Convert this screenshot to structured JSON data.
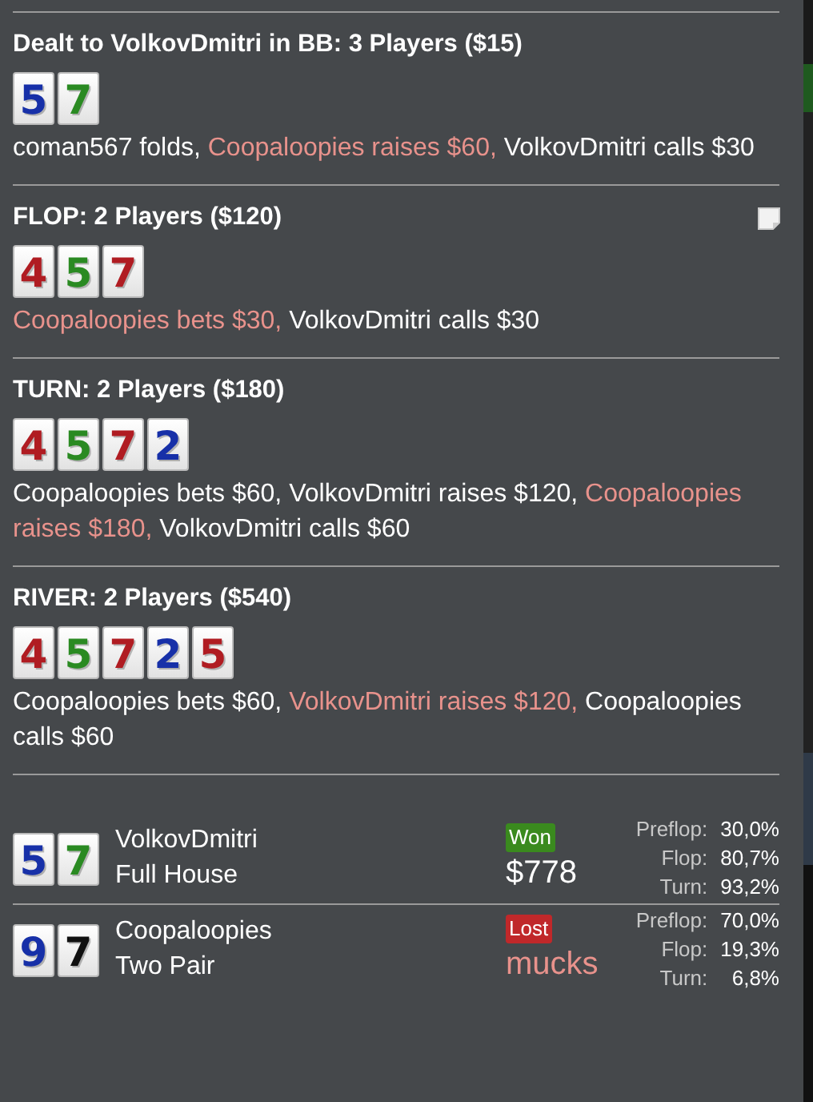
{
  "streets": [
    {
      "title": "Dealt to VolkovDmitri in BB: 3 Players ($15)",
      "note": false,
      "cards": [
        {
          "rank": "5",
          "color": "#1730a8"
        },
        {
          "rank": "7",
          "color": "#2a8a22"
        }
      ],
      "actions": [
        {
          "text": "coman567 folds,",
          "aggressive": false
        },
        {
          "text": "Coopaloopies raises $60,",
          "aggressive": true
        },
        {
          "text": "VolkovDmitri calls $30",
          "aggressive": false
        }
      ]
    },
    {
      "title": "FLOP: 2 Players ($120)",
      "note": true,
      "cards": [
        {
          "rank": "4",
          "color": "#b01c22"
        },
        {
          "rank": "5",
          "color": "#2a8a22"
        },
        {
          "rank": "7",
          "color": "#b01c22"
        }
      ],
      "actions": [
        {
          "text": "Coopaloopies bets $30,",
          "aggressive": true
        },
        {
          "text": "VolkovDmitri calls $30",
          "aggressive": false
        }
      ]
    },
    {
      "title": "TURN: 2 Players ($180)",
      "note": false,
      "cards": [
        {
          "rank": "4",
          "color": "#b01c22"
        },
        {
          "rank": "5",
          "color": "#2a8a22"
        },
        {
          "rank": "7",
          "color": "#b01c22"
        },
        {
          "rank": "2",
          "color": "#1730a8"
        }
      ],
      "actions": [
        {
          "text": "Coopaloopies bets $60,",
          "aggressive": false
        },
        {
          "text": "VolkovDmitri raises $120,",
          "aggressive": false
        },
        {
          "text": "Coopaloopies raises $180,",
          "aggressive": true
        },
        {
          "text": "VolkovDmitri calls $60",
          "aggressive": false
        }
      ]
    },
    {
      "title": "RIVER: 2 Players ($540)",
      "note": false,
      "cards": [
        {
          "rank": "4",
          "color": "#b01c22"
        },
        {
          "rank": "5",
          "color": "#2a8a22"
        },
        {
          "rank": "7",
          "color": "#b01c22"
        },
        {
          "rank": "2",
          "color": "#1730a8"
        },
        {
          "rank": "5",
          "color": "#b01c22"
        }
      ],
      "actions": [
        {
          "text": "Coopaloopies bets $60,",
          "aggressive": false
        },
        {
          "text": "VolkovDmitri raises $120,",
          "aggressive": true
        },
        {
          "text": "Coopaloopies calls $60",
          "aggressive": false
        }
      ]
    }
  ],
  "players": [
    {
      "name": "VolkovDmitri",
      "hand": "Full House",
      "cards": [
        {
          "rank": "5",
          "color": "#1730a8"
        },
        {
          "rank": "7",
          "color": "#2a8a22"
        }
      ],
      "won": true,
      "badge": "Won",
      "result": "$778",
      "equity": [
        {
          "label": "Preflop:",
          "value": "30,0%"
        },
        {
          "label": "Flop:",
          "value": "80,7%"
        },
        {
          "label": "Turn:",
          "value": "93,2%"
        }
      ]
    },
    {
      "name": "Coopaloopies",
      "hand": "Two Pair",
      "cards": [
        {
          "rank": "9",
          "color": "#1730a8"
        },
        {
          "rank": "7",
          "color": "#111111"
        }
      ],
      "won": false,
      "badge": "Lost",
      "result": "mucks",
      "equity": [
        {
          "label": "Preflop:",
          "value": "70,0%"
        },
        {
          "label": "Flop:",
          "value": "19,3%"
        },
        {
          "label": "Turn:",
          "value": "6,8%"
        }
      ]
    }
  ]
}
